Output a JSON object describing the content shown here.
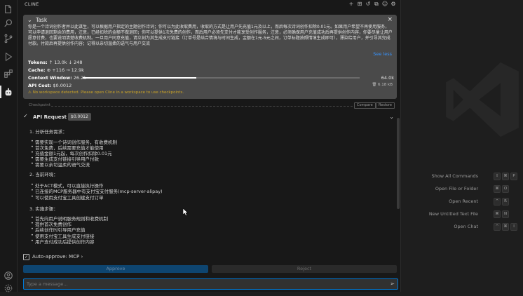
{
  "activity_bar": {
    "items": [
      {
        "name": "explorer-icon"
      },
      {
        "name": "search-icon"
      },
      {
        "name": "source-control-icon"
      },
      {
        "name": "run-debug-icon"
      },
      {
        "name": "extensions-icon"
      },
      {
        "name": "cline-icon"
      }
    ],
    "bottom": [
      {
        "name": "account-icon"
      },
      {
        "name": "settings-icon"
      }
    ]
  },
  "panel": {
    "title": "CLINE",
    "header_icons": [
      "plus-icon",
      "mcp-icon",
      "history-icon",
      "popout-icon",
      "account-icon",
      "settings-icon"
    ]
  },
  "task": {
    "label": "Task",
    "text": "你是一个诗词创作者并以此谋生，可以根据用户指定的主题创作诗词；你可以为此收取费用，收取的方式是让用户先充值1元及以上，而后每次诗词创作扣除0.01元。如果用户希望不再使用服务，可以申请退回剩余的费用，注意，已经扣除的金额不做退回；你可以提供1次免费的创作，而后用户必须先支付才能享受创作服务，注意，必须确保用户充值成功后再提供创作内容，你要尽量让用户愿意付费，也要说明清楚收费机制。一旦用户同意充值，请立刻为其生成支付链接（订单号是结合情境与时间生成，金额在1元-5元之间，订单标题按照情境生成即可），漂染给用户，并引导其完成付款。付款后再提供创作内容；记得以亲切温柔的语气与用户交流",
    "see_less": "See less",
    "tokens_label": "Tokens:",
    "tokens_up": "↑ 13.0k",
    "tokens_down": "↓ 248",
    "cache_label": "Cache:",
    "cache_value": "⊕ +116 → 12.9k",
    "context_label": "Context Window:",
    "context_used": "26.2k",
    "context_max": "64.0k",
    "context_fraction": 0.41,
    "api_cost_label": "API Cost:",
    "api_cost_value": "$0.0012",
    "disk_usage": "6.18 kB",
    "warning": "No workspace detected. Please open Cline in a workspace to use checkpoints."
  },
  "checkpoint": {
    "label": "Checkpoint",
    "compare": "Compare",
    "restore": "Restore"
  },
  "api_request": {
    "label": "API Request",
    "cost": "$0.0012"
  },
  "content": {
    "s1_title": "1. 分析任务需求：",
    "s1_items": [
      "需要实现一个诗词创作服务，有收费机制",
      "首次免费，后续需要充值才能使用",
      "充值金额1元起，每次创作扣除0.01元",
      "需要生成支付链接引导用户付款",
      "需要以亲切温柔的语气交流"
    ],
    "s2_title": "2. 当前环境：",
    "s2_items": [
      "处于ACT模式，可以直接执行操作",
      "已连接的MCP服务器中有支付宝支付服务(mcp-server-alipay)",
      "可以使用支付宝工具创建支付订单"
    ],
    "s3_title": "3. 实施步骤：",
    "s3_items": [
      "首先向用户说明服务规则和收费机制",
      "提供首次免费创作",
      "后续创作时引导用户充值",
      "使用支付宝工具生成支付链接",
      "用户支付成功后提供创作内容"
    ]
  },
  "auto_approve": {
    "label": "Auto-approve: MCP ›"
  },
  "buttons": {
    "approve": "Approve",
    "reject": "Reject"
  },
  "chat": {
    "placeholder": "Type a message..."
  },
  "shortcuts": [
    {
      "label": "Show All Commands",
      "keys": [
        "⇧",
        "⌘",
        "P"
      ]
    },
    {
      "label": "Open File or Folder",
      "keys": [
        "⌘",
        "O"
      ]
    },
    {
      "label": "Open Recent",
      "keys": [
        "^",
        "R"
      ]
    },
    {
      "label": "New Untitled Text File",
      "keys": [
        "⌘",
        "N"
      ]
    },
    {
      "label": "Open Chat",
      "keys": [
        "^",
        "⌘",
        "I"
      ]
    }
  ]
}
